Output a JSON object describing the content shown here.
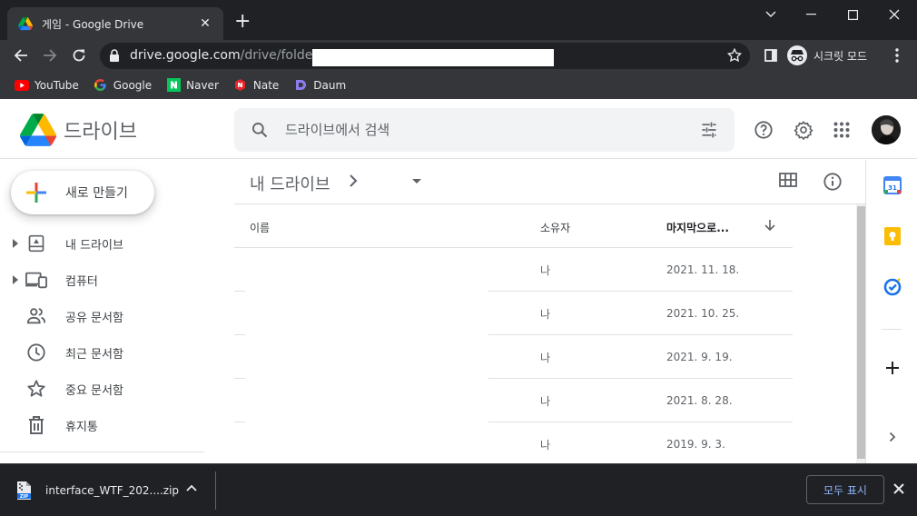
{
  "browser": {
    "tab_title": "게임 - Google Drive",
    "url_host": "drive.google.com",
    "url_path": "/drive/folders/",
    "incognito_label": "시크릿 모드",
    "bookmarks": [
      {
        "label": "YouTube",
        "icon": "youtube-icon"
      },
      {
        "label": "Google",
        "icon": "google-icon"
      },
      {
        "label": "Naver",
        "icon": "naver-icon"
      },
      {
        "label": "Nate",
        "icon": "nate-icon"
      },
      {
        "label": "Daum",
        "icon": "daum-icon"
      }
    ]
  },
  "drive": {
    "app_name": "드라이브",
    "search_placeholder": "드라이브에서 검색",
    "new_button": "새로 만들기",
    "nav": [
      {
        "label": "내 드라이브",
        "icon": "my-drive-icon",
        "expandable": true
      },
      {
        "label": "컴퓨터",
        "icon": "computers-icon",
        "expandable": true
      },
      {
        "label": "공유 문서함",
        "icon": "shared-icon",
        "expandable": false
      },
      {
        "label": "최근 문서함",
        "icon": "recent-icon",
        "expandable": false
      },
      {
        "label": "중요 문서함",
        "icon": "starred-icon",
        "expandable": false
      },
      {
        "label": "휴지통",
        "icon": "trash-icon",
        "expandable": false
      }
    ],
    "breadcrumb_root": "내 드라이브",
    "columns": {
      "name": "이름",
      "owner": "소유자",
      "modified": "마지막으로..."
    },
    "rows": [
      {
        "name": "",
        "owner": "나",
        "modified": "2021. 11. 18."
      },
      {
        "name": "",
        "owner": "나",
        "modified": "2021. 10. 25."
      },
      {
        "name": "",
        "owner": "나",
        "modified": "2021. 9. 19."
      },
      {
        "name": "",
        "owner": "나",
        "modified": "2021. 8. 28."
      },
      {
        "name": "",
        "owner": "나",
        "modified": "2019. 9. 3."
      }
    ]
  },
  "downloads": {
    "file_name": "interface_WTF_202....zip",
    "icon_label": "ZIP",
    "show_all": "모두 표시"
  },
  "colors": {
    "chrome_dark": "#202124",
    "chrome_toolbar": "#35363a",
    "google_blue": "#4285f4",
    "google_red": "#ea4335",
    "google_yellow": "#fbbc04",
    "google_green": "#34a853",
    "link_blue": "#8ab4f8"
  }
}
